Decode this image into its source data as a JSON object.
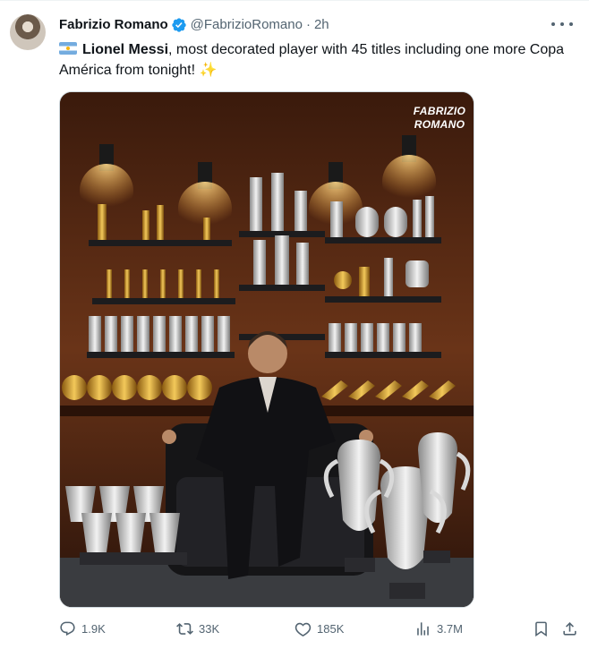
{
  "tweet": {
    "author_name": "Fabrizio Romano",
    "handle": "@FabrizioRomano",
    "separator": "·",
    "time": "2h",
    "text_bold": "Lionel Messi",
    "text_rest": ", most decorated player with 45 titles including one more Copa América from tonight! ",
    "emoji": "✨",
    "flag_icon": "argentina-flag-icon",
    "image_watermark": "FABRIZIO\nROMANO"
  },
  "actions": {
    "replies": "1.9K",
    "reposts": "33K",
    "likes": "185K",
    "views": "3.7M"
  },
  "colors": {
    "text": "#0f1419",
    "secondary": "#536471",
    "verified": "#1d9bf0"
  }
}
